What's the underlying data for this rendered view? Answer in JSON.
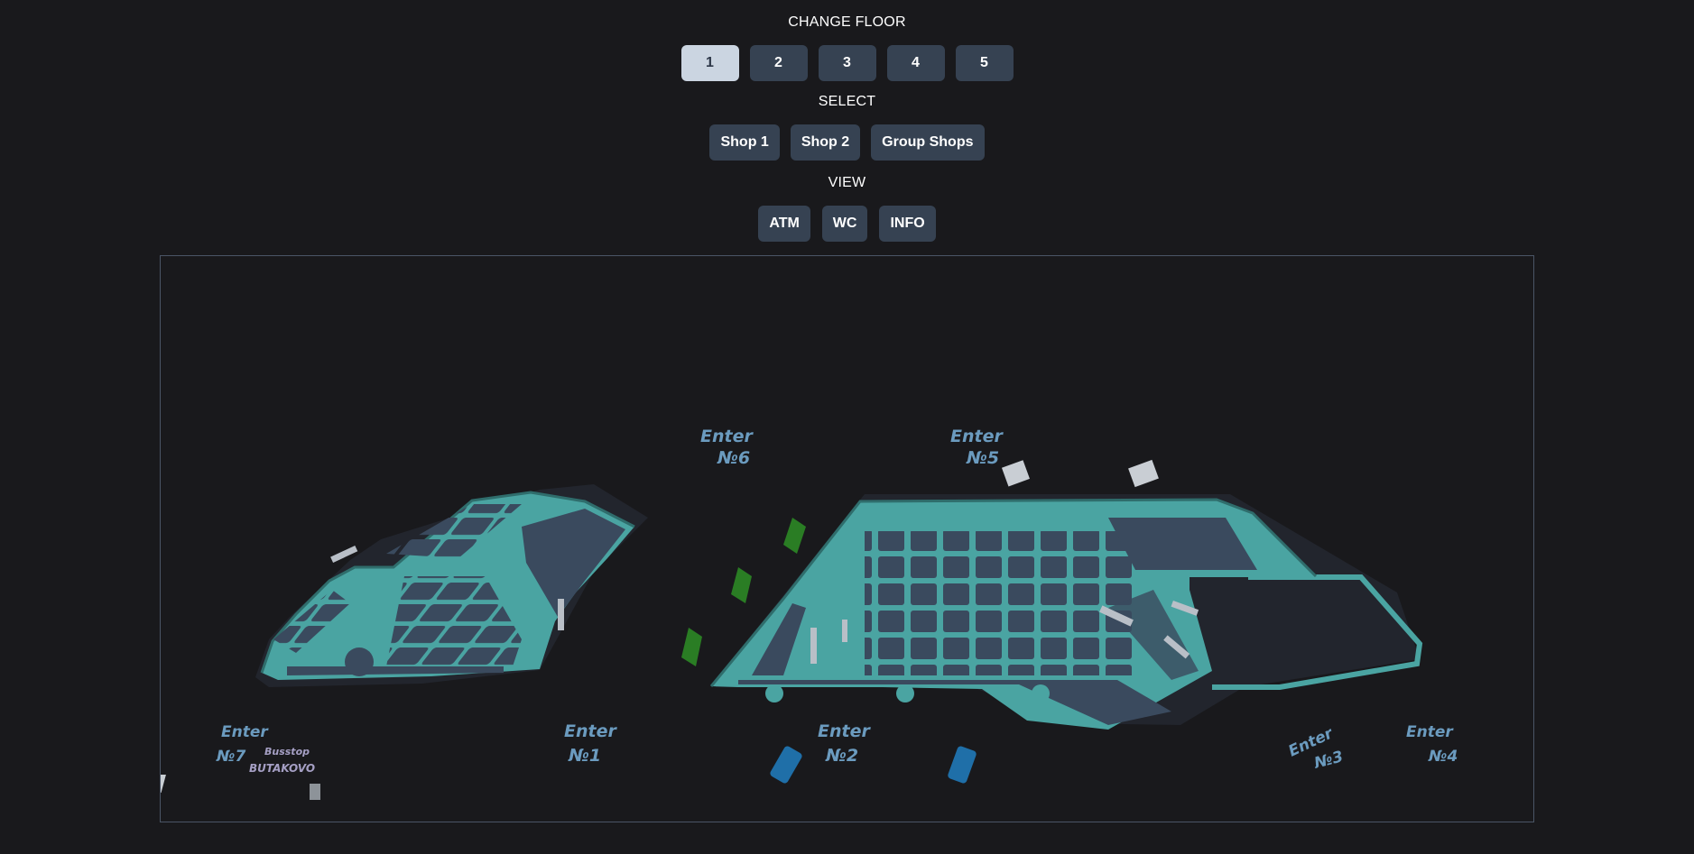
{
  "change_floor": {
    "label": "CHANGE FLOOR",
    "floors": [
      "1",
      "2",
      "3",
      "4",
      "5"
    ],
    "active_floor": "1"
  },
  "select": {
    "label": "SELECT",
    "buttons": [
      "Shop 1",
      "Shop 2",
      "Group Shops"
    ]
  },
  "view": {
    "label": "VIEW",
    "buttons": [
      "ATM",
      "WC",
      "INFO"
    ]
  },
  "map": {
    "entrances": {
      "enter6": {
        "line1": "Enter",
        "line2": "№6"
      },
      "enter5": {
        "line1": "Enter",
        "line2": "№5"
      },
      "enter7": {
        "line1": "Enter",
        "line2": "№7"
      },
      "enter1": {
        "line1": "Enter",
        "line2": "№1"
      },
      "enter2": {
        "line1": "Enter",
        "line2": "№2"
      },
      "enter3": {
        "line1": "Enter",
        "line2": "№3"
      },
      "enter4": {
        "line1": "Enter",
        "line2": "№4"
      }
    },
    "busstop": {
      "line1": "Busstop",
      "line2": "BUTAKOVO"
    }
  },
  "colors": {
    "background": "#19191c",
    "button": "#364252",
    "button_active": "#cbd5e1",
    "floor_teal": "#4aa4a2",
    "shop_block": "#3a4a5e",
    "entrance_text": "#6b9bbf",
    "tree": "#2a7d24",
    "car": "#1f6fa8"
  }
}
